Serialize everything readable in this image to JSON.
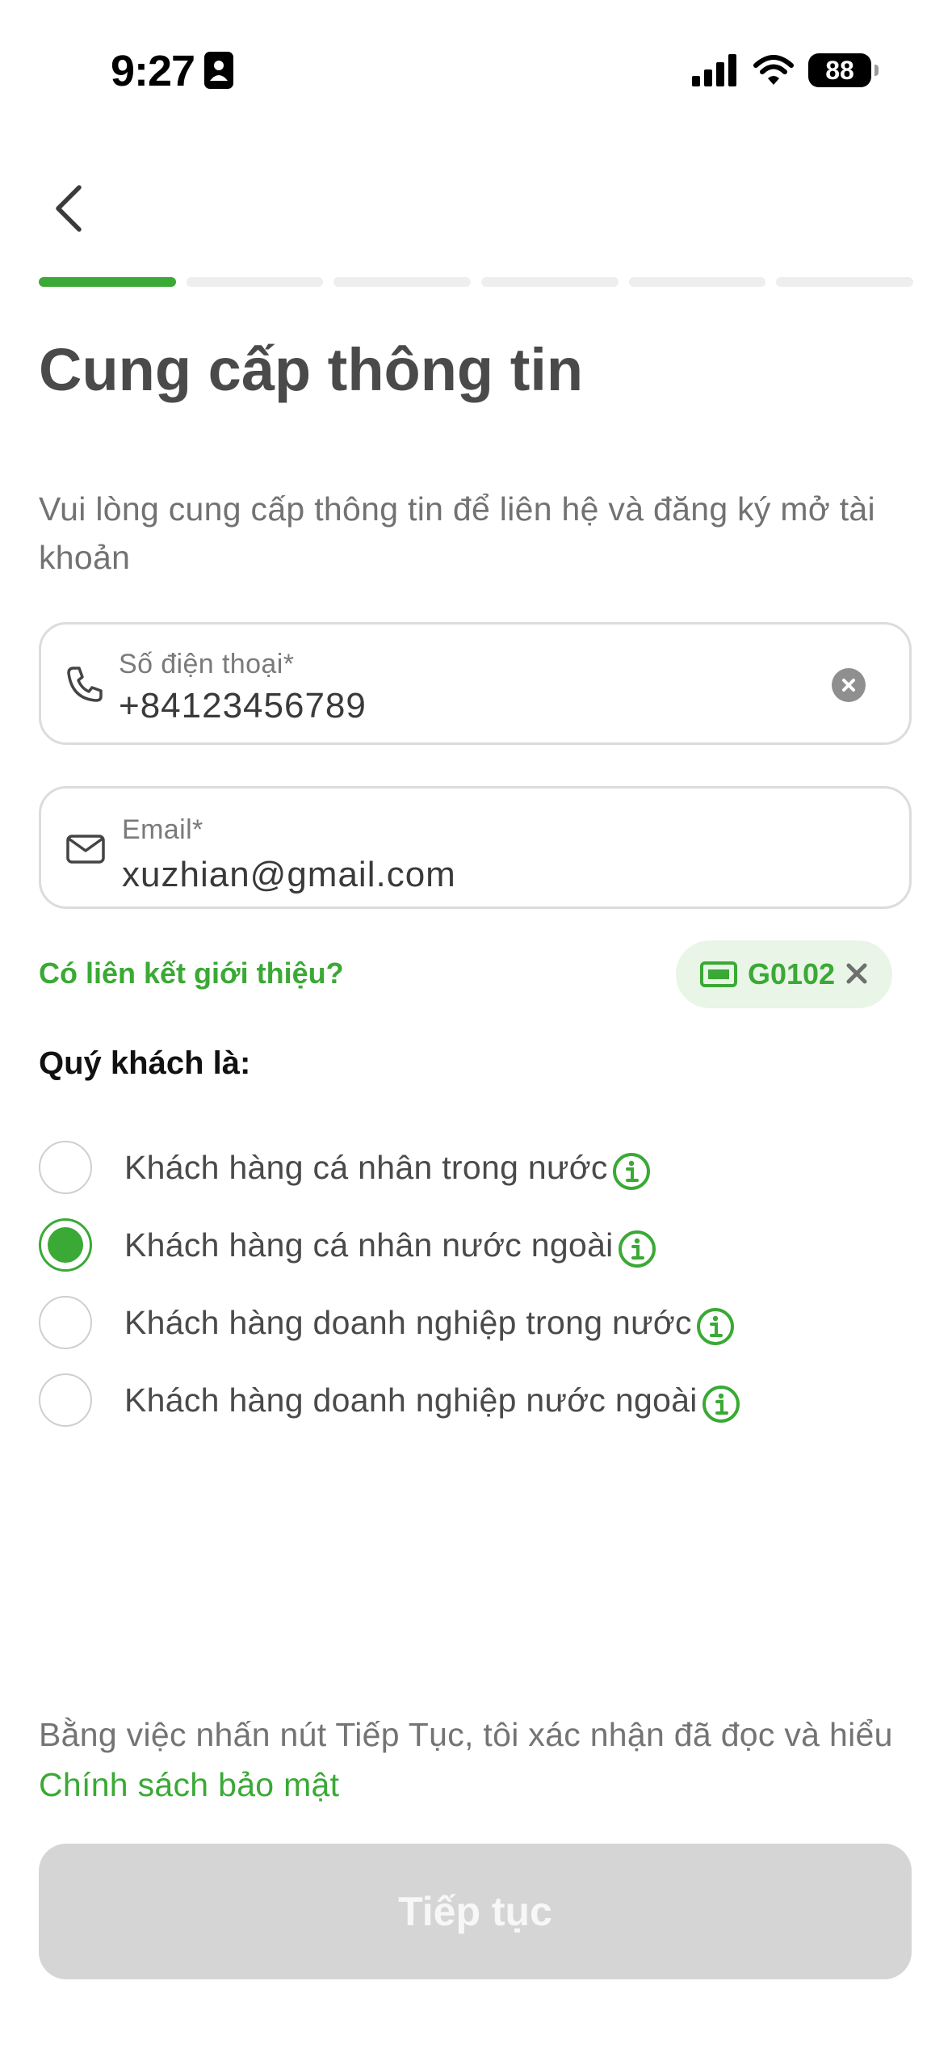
{
  "status_bar": {
    "time": "9:27",
    "battery": "88"
  },
  "progress": {
    "total_steps": 6,
    "current_step": 1
  },
  "page": {
    "title": "Cung cấp thông tin",
    "subtitle": "Vui lòng cung cấp thông tin để liên hệ và đăng ký mở tài khoản"
  },
  "form": {
    "phone": {
      "label": "Số điện thoại*",
      "value": "+84123456789"
    },
    "email": {
      "label": "Email*",
      "value": "xuzhian@gmail.com"
    }
  },
  "referral": {
    "link_text": "Có liên kết giới thiệu?",
    "code": "G0102"
  },
  "customer_type": {
    "question": "Quý khách là:",
    "options": [
      {
        "label": "Khách hàng cá nhân trong nước",
        "selected": false
      },
      {
        "label": "Khách hàng cá nhân nước ngoài",
        "selected": true
      },
      {
        "label": "Khách hàng doanh nghiệp trong nước",
        "selected": false
      },
      {
        "label": "Khách hàng doanh nghiệp nước ngoài",
        "selected": false
      }
    ]
  },
  "disclaimer": {
    "text": "Bằng việc nhấn nút Tiếp Tục, tôi xác nhận đã đọc và hiểu ",
    "link": "Chính sách bảo mật"
  },
  "continue_button": {
    "label": "Tiếp tục",
    "enabled": false
  },
  "colors": {
    "accent": "#3aa935",
    "disabled_button": "#d5d5d5",
    "chip_bg": "#e9f5e7"
  }
}
